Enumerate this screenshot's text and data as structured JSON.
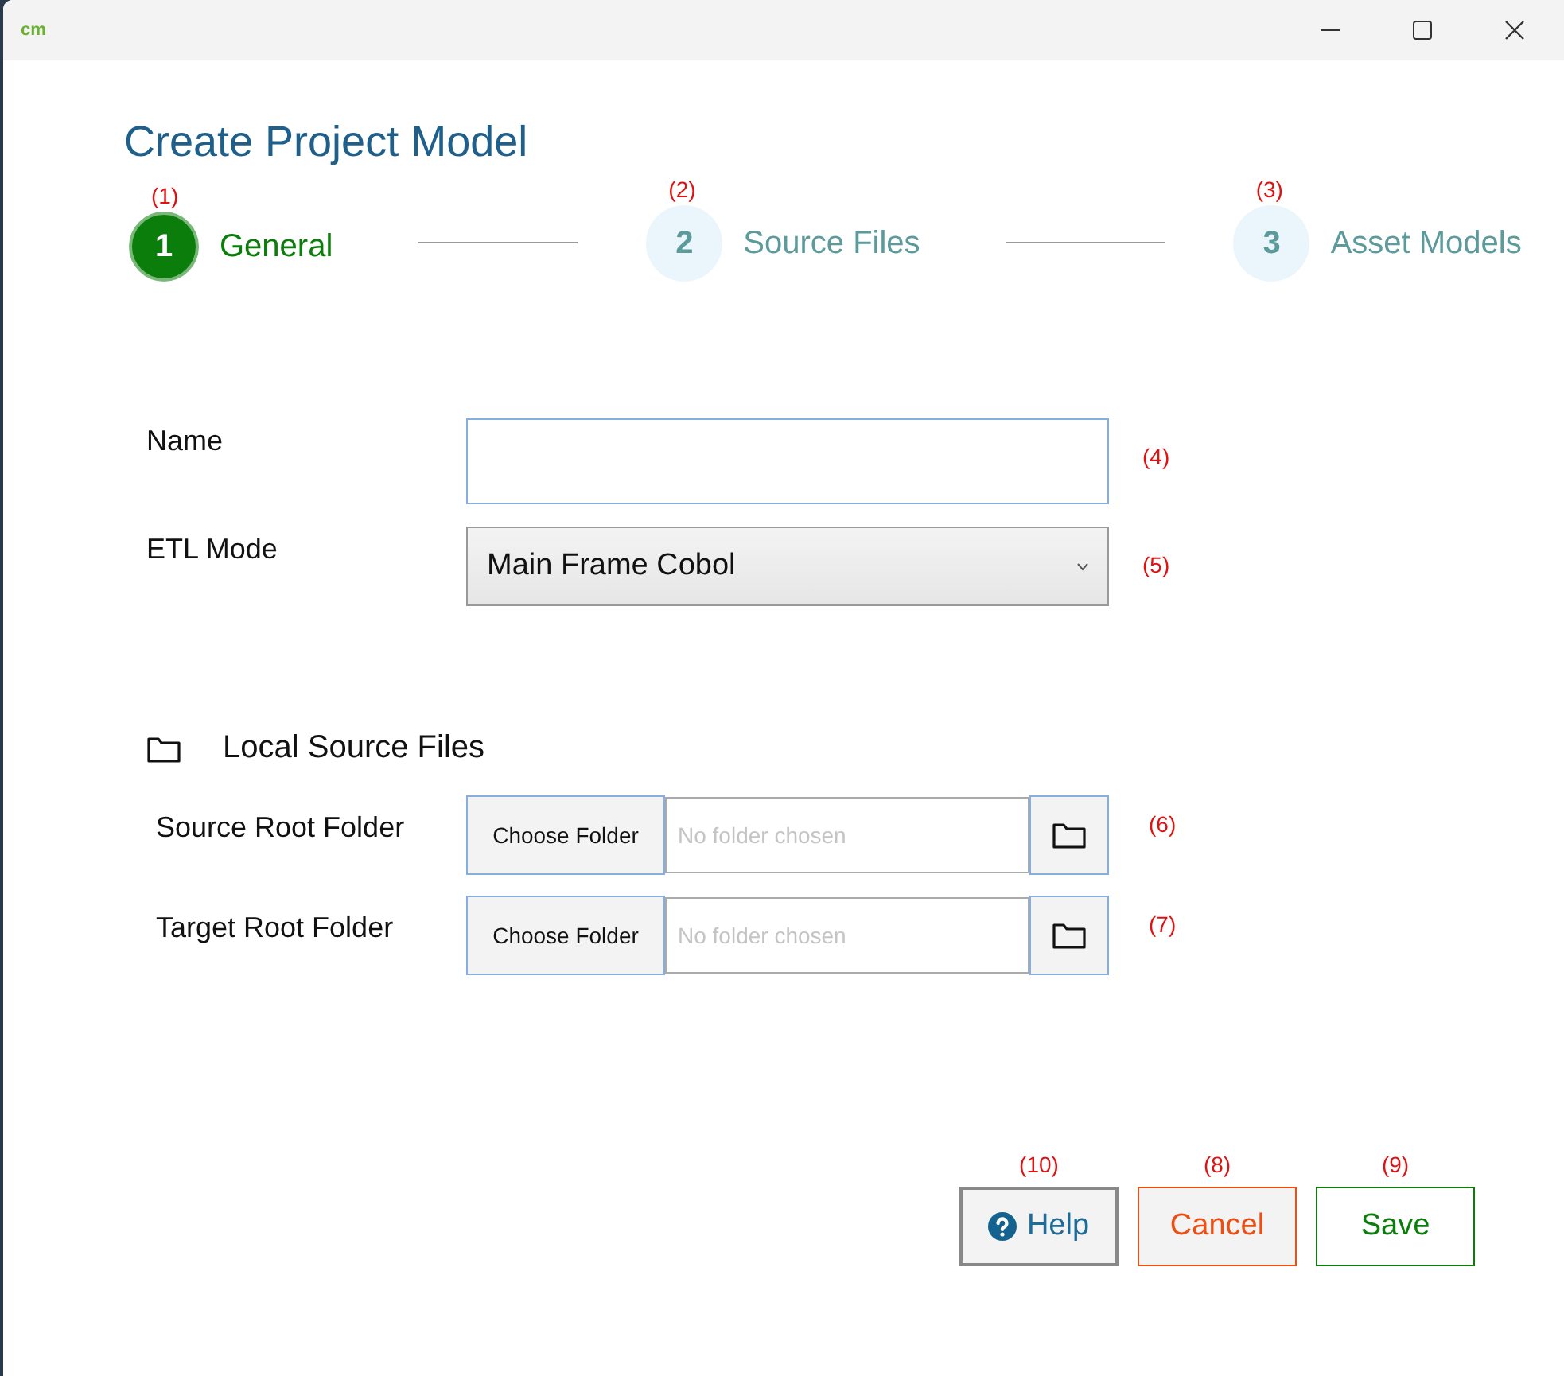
{
  "window": {
    "logo": "cm",
    "title": "Create Project Model"
  },
  "steps": [
    {
      "number": "1",
      "label": "General",
      "annotation": "(1)",
      "selected": true
    },
    {
      "number": "2",
      "label": "Source Files",
      "annotation": "(2)",
      "selected": false
    },
    {
      "number": "3",
      "label": "Asset Models",
      "annotation": "(3)",
      "selected": false
    }
  ],
  "fields": [
    {
      "kind": "text",
      "label": "Name",
      "annotation": "(4)"
    },
    {
      "kind": "select",
      "label": "ETL Mode",
      "value": "Main Frame Cobol",
      "annotation": "(5)"
    }
  ],
  "local_source": {
    "title": "Local Source Files",
    "rows": [
      {
        "label": "Source Root Folder",
        "button": "Choose Folder",
        "placeholder": "No folder chosen",
        "annotation": "(6)"
      },
      {
        "label": "Target Root Folder",
        "button": "Choose Folder",
        "placeholder": "No folder chosen",
        "annotation": "(7)"
      }
    ]
  },
  "buttons": [
    {
      "kind": "help",
      "label": "Help",
      "annotation": "(10)"
    },
    {
      "kind": "cancel",
      "label": "Cancel",
      "annotation": "(8)"
    },
    {
      "kind": "save",
      "label": "Save",
      "annotation": "(9)"
    }
  ]
}
